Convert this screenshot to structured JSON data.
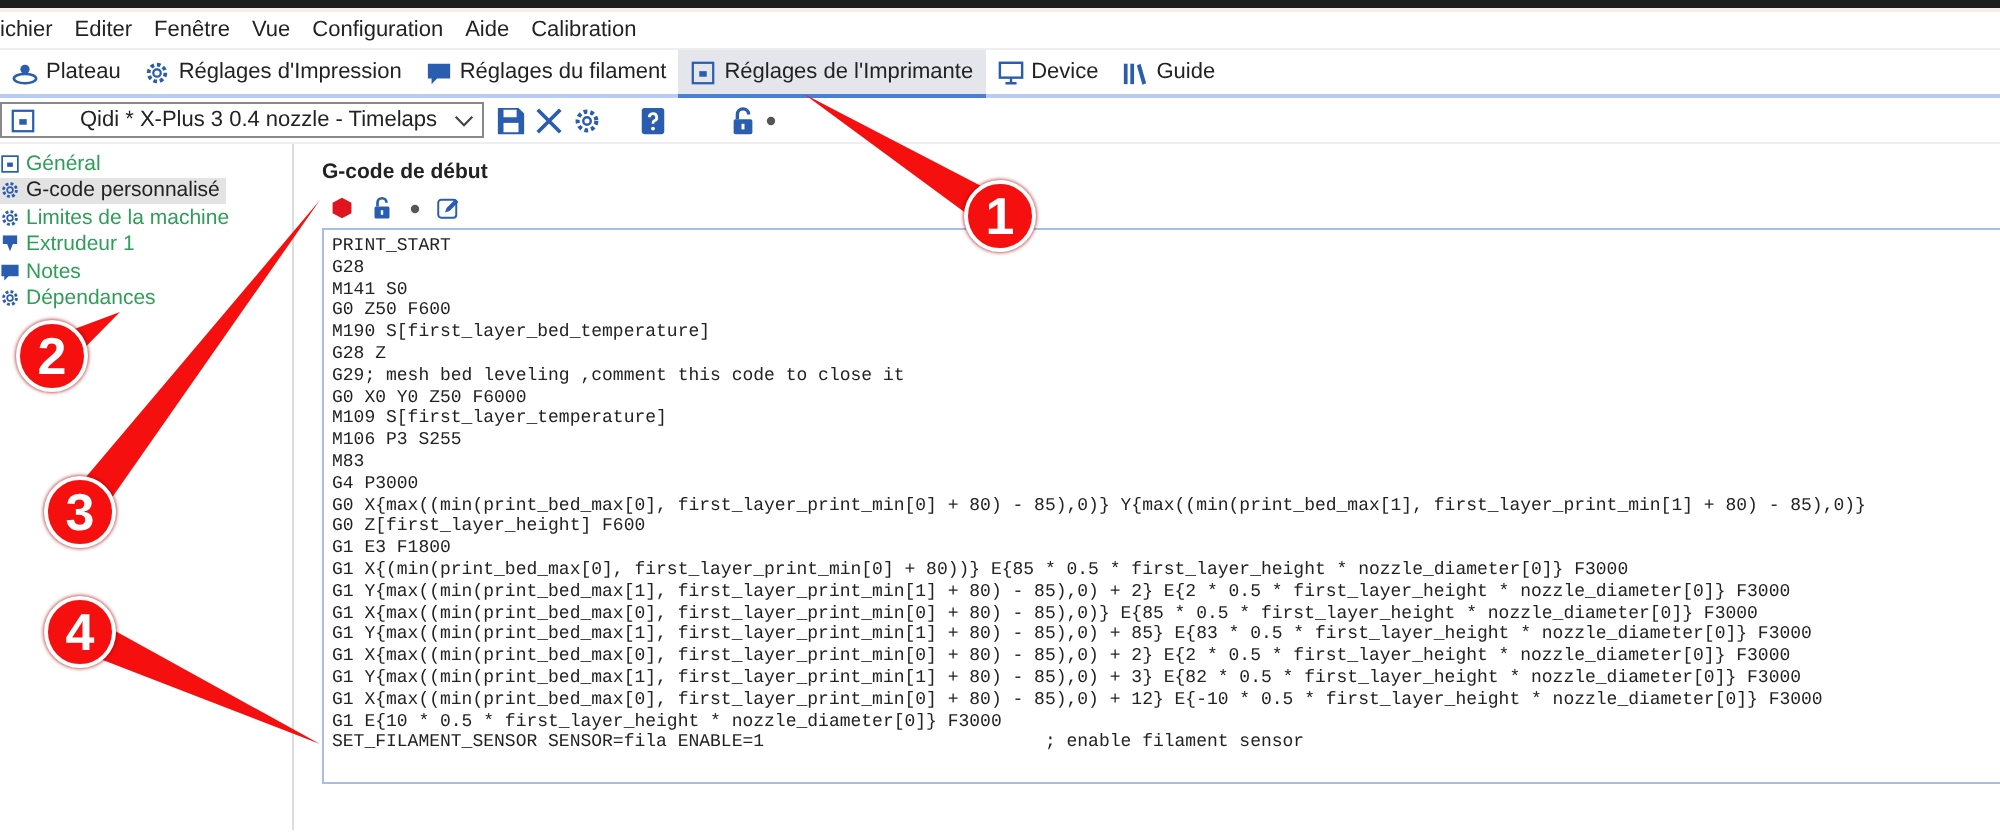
{
  "menu": [
    "ichier",
    "Editer",
    "Fenêtre",
    "Vue",
    "Configuration",
    "Aide",
    "Calibration"
  ],
  "tabs": [
    {
      "label": "Plateau",
      "kind": "plate",
      "selected": false
    },
    {
      "label": "Réglages d'Impression",
      "kind": "gear",
      "selected": false
    },
    {
      "label": "Réglages du filament",
      "kind": "bubble",
      "selected": false
    },
    {
      "label": "Réglages de l'Imprimante",
      "kind": "printer",
      "selected": true
    },
    {
      "label": "Device",
      "kind": "monitor",
      "selected": false
    },
    {
      "label": "Guide",
      "kind": "books",
      "selected": false
    }
  ],
  "preset": {
    "value": "Qidi * X-Plus 3 0.4 nozzle - Timelaps"
  },
  "sidebar": {
    "items": [
      {
        "label": "Général",
        "kind": "printer",
        "selected": false
      },
      {
        "label": "G-code personnalisé",
        "kind": "gear",
        "selected": true
      },
      {
        "label": "Limites de la machine",
        "kind": "gear",
        "selected": false
      },
      {
        "label": "Extrudeur 1",
        "kind": "nozzle",
        "selected": false
      },
      {
        "label": "Notes",
        "kind": "bubble",
        "selected": false
      },
      {
        "label": "Dépendances",
        "kind": "gear",
        "selected": false
      }
    ]
  },
  "section": {
    "title": "G-code de début",
    "code": [
      "PRINT_START",
      "G28",
      "M141 S0",
      "G0 Z50 F600",
      "M190 S[first_layer_bed_temperature]",
      "G28 Z",
      "G29; mesh bed leveling ,comment this code to close it",
      "G0 X0 Y0 Z50 F6000",
      "M109 S[first_layer_temperature]",
      "M106 P3 S255",
      "M83",
      "G4 P3000",
      "G0 X{max((min(print_bed_max[0], first_layer_print_min[0] + 80) - 85),0)} Y{max((min(print_bed_max[1], first_layer_print_min[1] + 80) - 85),0)}",
      "G0 Z[first_layer_height] F600",
      "G1 E3 F1800",
      "G1 X{(min(print_bed_max[0], first_layer_print_min[0] + 80))} E{85 * 0.5 * first_layer_height * nozzle_diameter[0]} F3000",
      "G1 Y{max((min(print_bed_max[1], first_layer_print_min[1] + 80) - 85),0) + 2} E{2 * 0.5 * first_layer_height * nozzle_diameter[0]} F3000",
      "G1 X{max((min(print_bed_max[0], first_layer_print_min[0] + 80) - 85),0)} E{85 * 0.5 * first_layer_height * nozzle_diameter[0]} F3000",
      "G1 Y{max((min(print_bed_max[1], first_layer_print_min[1] + 80) - 85),0) + 85} E{83 * 0.5 * first_layer_height * nozzle_diameter[0]} F3000",
      "G1 X{max((min(print_bed_max[0], first_layer_print_min[0] + 80) - 85),0) + 2} E{2 * 0.5 * first_layer_height * nozzle_diameter[0]} F3000",
      "G1 Y{max((min(print_bed_max[1], first_layer_print_min[1] + 80) - 85),0) + 3} E{82 * 0.5 * first_layer_height * nozzle_diameter[0]} F3000",
      "G1 X{max((min(print_bed_max[0], first_layer_print_min[0] + 80) - 85),0) + 12} E{-10 * 0.5 * first_layer_height * nozzle_diameter[0]} F3000",
      "G1 E{10 * 0.5 * first_layer_height * nozzle_diameter[0]} F3000",
      "SET_FILAMENT_SENSOR SENSOR=fila ENABLE=1                          ; enable filament sensor"
    ]
  },
  "annotations": [
    {
      "number": "1"
    },
    {
      "number": "2"
    },
    {
      "number": "3"
    },
    {
      "number": "4"
    }
  ]
}
